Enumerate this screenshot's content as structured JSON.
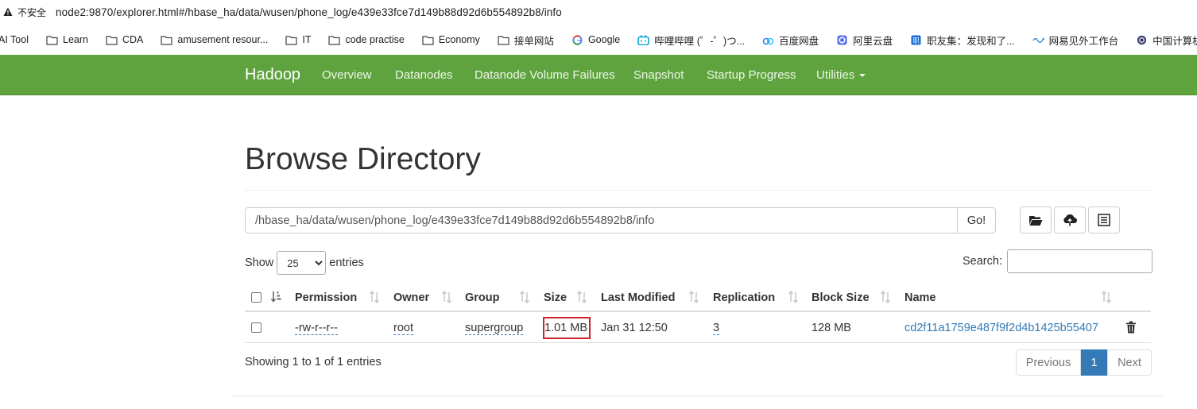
{
  "browser": {
    "security_label": "不安全",
    "url": "node2:9870/explorer.html#/hbase_ha/data/wusen/phone_log/e439e33fce7d149b88d92d6b554892b8/info",
    "bookmarks": [
      {
        "label": "AI Tool",
        "icon": "none"
      },
      {
        "label": "Learn",
        "icon": "folder-icon"
      },
      {
        "label": "CDA",
        "icon": "folder-icon"
      },
      {
        "label": "amusement resour...",
        "icon": "folder-icon"
      },
      {
        "label": "IT",
        "icon": "folder-icon"
      },
      {
        "label": "code practise",
        "icon": "folder-icon"
      },
      {
        "label": "Economy",
        "icon": "folder-icon"
      },
      {
        "label": "接单网站",
        "icon": "folder-icon"
      },
      {
        "label": "Google",
        "icon": "google-icon"
      },
      {
        "label": "哔哩哔哩 (゜-゜)つ...",
        "icon": "bilibili-icon"
      },
      {
        "label": "百度网盘",
        "icon": "baidu-pan-icon"
      },
      {
        "label": "阿里云盘",
        "icon": "aliyun-pan-icon"
      },
      {
        "label": "职友集：发现和了...",
        "icon": "jobui-icon"
      },
      {
        "label": "网易见外工作台",
        "icon": "netease-icon"
      },
      {
        "label": "中国计算机技术",
        "icon": "ccf-icon"
      }
    ]
  },
  "navbar": {
    "brand": "Hadoop",
    "links": [
      "Overview",
      "Datanodes",
      "Datanode Volume Failures",
      "Snapshot",
      "Startup Progress",
      "Utilities"
    ]
  },
  "page": {
    "title": "Browse Directory",
    "path_value": "/hbase_ha/data/wusen/phone_log/e439e33fce7d149b88d92d6b554892b8/info",
    "go_label": "Go!",
    "toolbar_icons": [
      "folder-open-icon",
      "cloud-upload-icon",
      "list-icon"
    ],
    "show_label": "Show",
    "entries_label": "entries",
    "page_size": "25",
    "page_size_options": [
      "25"
    ],
    "search_label": "Search:"
  },
  "table": {
    "columns": [
      "Permission",
      "Owner",
      "Group",
      "Size",
      "Last Modified",
      "Replication",
      "Block Size",
      "Name"
    ],
    "rows": [
      {
        "permission": "-rw-r--r--",
        "owner": "root",
        "group": "supergroup",
        "size": "1.01 MB",
        "last_modified": "Jan 31 12:50",
        "replication": "3",
        "block_size": "128 MB",
        "name": "cd2f11a1759e487f9f2d4b1425b55407"
      }
    ],
    "info": "Showing 1 to 1 of 1 entries"
  },
  "pagination": {
    "previous": "Previous",
    "current": "1",
    "next": "Next"
  },
  "colors": {
    "navbar": "#5fa33e",
    "link": "#337ab7",
    "highlight_box": "#d0202a"
  }
}
